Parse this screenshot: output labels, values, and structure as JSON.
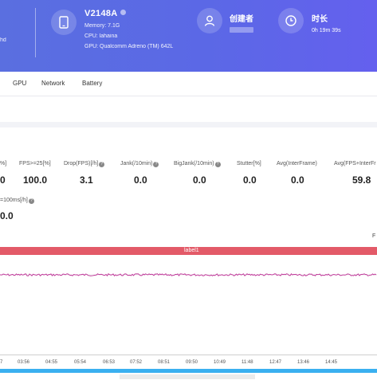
{
  "header": {
    "edge_text": "hd",
    "device": {
      "name": "V2148A",
      "memory": "Memory: 7.1G",
      "cpu": "CPU: lahaina",
      "gpu": "GPU: Qualcomm Adreno (TM) 642L"
    },
    "creator": {
      "label": "创建者"
    },
    "duration": {
      "label": "时长",
      "value": "0h 19m 39s"
    }
  },
  "tabs": [
    "GPU",
    "Network",
    "Battery"
  ],
  "metrics": [
    {
      "label": "%]",
      "value": "0"
    },
    {
      "label": "FPS>=25[%]",
      "value": "100.0"
    },
    {
      "label": "Drop(FPS)[/h]",
      "value": "3.1",
      "help": "?"
    },
    {
      "label": "Jank(/10min)",
      "value": "0.0",
      "help": "?"
    },
    {
      "label": "BigJank(/10min)",
      "value": "0.0",
      "help": "?"
    },
    {
      "label": "Stutter[%]",
      "value": "0.0"
    },
    {
      "label": "Avg(InterFrame)",
      "value": "0.0"
    },
    {
      "label": "Avg(FPS+InterFr",
      "value": "59.8"
    }
  ],
  "metric_row2": {
    "label": "=100ms[/h]",
    "value": "0.0",
    "help": "?"
  },
  "chart": {
    "label_band": "label1",
    "corner_mark": "F",
    "x_ticks": [
      "7",
      "03:56",
      "04:55",
      "05:54",
      "06:53",
      "07:52",
      "08:51",
      "09:50",
      "10:49",
      "11:48",
      "12:47",
      "13:46",
      "14:45"
    ],
    "line_color": "#c0399a",
    "band_color": "#e35a68"
  }
}
